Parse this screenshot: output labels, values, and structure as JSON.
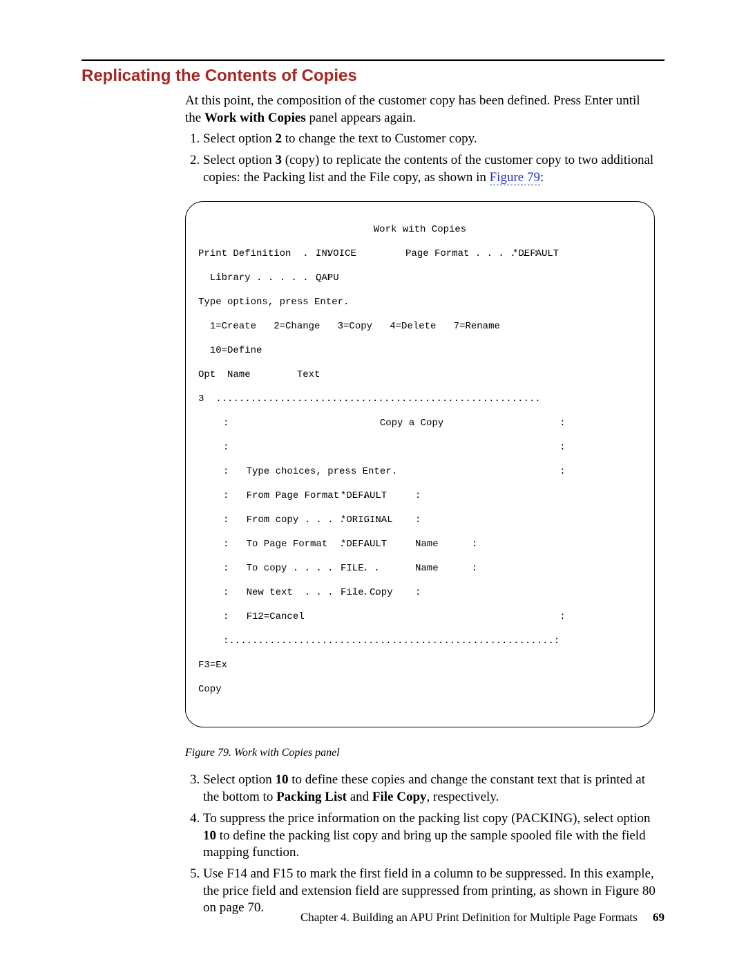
{
  "heading": "Replicating the Contents of Copies",
  "intro": {
    "p1a": "At this point, the composition of the customer copy has been defined. Press Enter until the ",
    "p1bold": "Work with Copies",
    "p1b": " panel appears again."
  },
  "steps1": {
    "s1a": "Select option ",
    "s1bold": "2",
    "s1b": " to change the text to Customer copy.",
    "s2a": "Select option ",
    "s2bold": "3",
    "s2b": " (copy) to replicate the contents of the customer copy to two additional copies: the Packing list and the File copy, as shown in ",
    "s2ref": "Figure 79",
    "s2c": ":"
  },
  "panel": {
    "title": "Work with Copies",
    "pd_lab": "Print Definition  . . :",
    "pd_val": "INVOICE",
    "pf_lab": "Page Format . . . . . :",
    "pf_val": "*DEFAULT",
    "lib_lab": "  Library . . . . . . :",
    "lib_val": "QAPU",
    "instr": "Type options, press Enter.",
    "opts1": "  1=Create   2=Change   3=Copy   4=Delete   7=Rename",
    "opts2": "  10=Define",
    "hdr": "Opt  Name        Text",
    "three": "3",
    "dots_top": "  ........................................................",
    "ov_title": ":                          Copy a Copy                    :",
    "ov_blank": ":                                                         :",
    "ov_instr": ":   Type choices, press Enter.                            :",
    "fpf_lab": ":   From Page Format  . . :",
    "fpf_val": "*DEFAULT",
    "fc_lab": ":   From copy . . . . . . :",
    "fc_val": "*ORIGINAL",
    "tpf_lab": ":   To Page Format  . . . .",
    "tpf_val": "*DEFAULT",
    "tpf_hint": "Name",
    "tc_lab": ":   To copy . . . . . . . .",
    "tc_val": "FILE",
    "tc_hint": "Name",
    "nt_lab": ":   New text  . . . . . . .",
    "nt_val": "File Copy",
    "f12": ":   F12=Cancel                                            :",
    "dots_bot": ":........................................................:",
    "f3": "F3=Ex",
    "copy": "Copy",
    "end_colon": ":"
  },
  "caption": "Figure 79. Work with Copies panel",
  "steps2": {
    "s3a": "Select option ",
    "s3bold": "10",
    "s3b": " to define these copies and change the constant text that is printed at the bottom to ",
    "s3bold2": "Packing List",
    "s3mid": " and ",
    "s3bold3": "File Copy",
    "s3c": ", respectively.",
    "s4a": "To suppress the price information on the packing list copy (PACKING), select option ",
    "s4bold": "10",
    "s4b": " to define the packing list copy and bring up the sample spooled file with the field mapping function.",
    "s5": "Use F14 and F15 to mark the first field in a column to be suppressed. In this example, the price field and extension field are suppressed from printing, as shown in Figure 80 on page 70."
  },
  "footer": {
    "chapter": "Chapter 4. Building an APU Print Definition for Multiple Page Formats",
    "page": "69"
  }
}
